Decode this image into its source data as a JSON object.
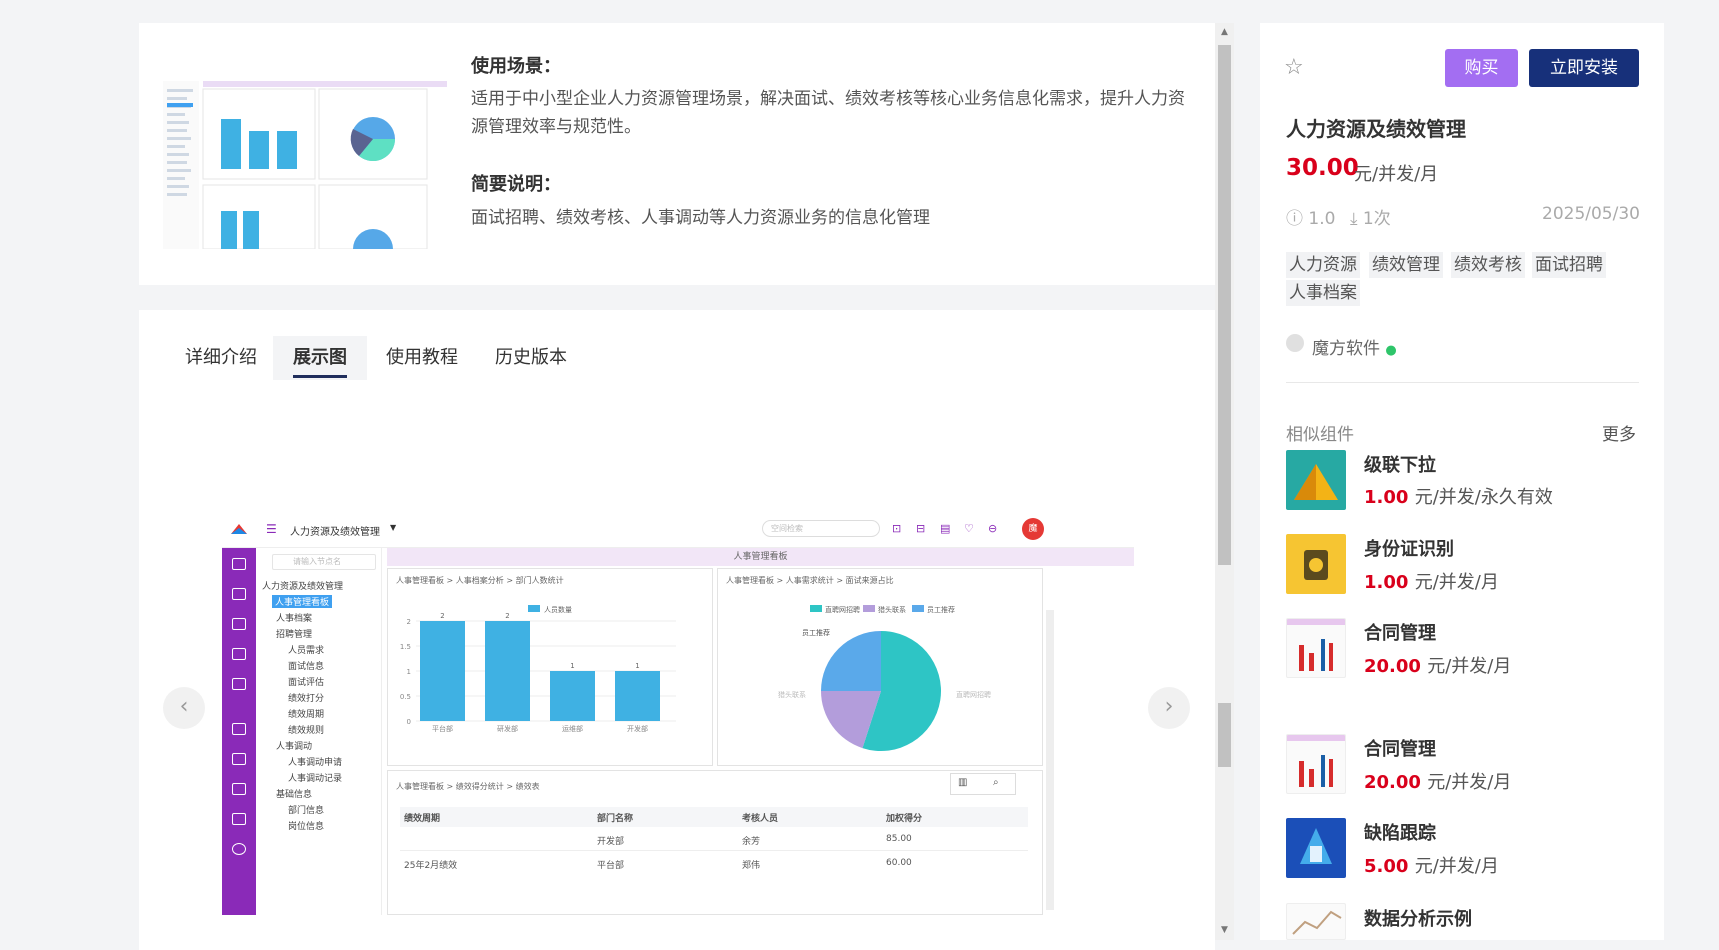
{
  "overview": {
    "scene_title": "使用场景：",
    "scene_text": "适用于中小型企业人力资源管理场景，解决面试、绩效考核等核心业务信息化需求，提升人力资源管理效率与规范性。",
    "brief_title": "简要说明：",
    "brief_text": "面试招聘、绩效考核、人事调动等人力资源业务的信息化管理"
  },
  "tabs": [
    "详细介绍",
    "展示图",
    "使用教程",
    "历史版本"
  ],
  "active_tab": "展示图",
  "carousel": {
    "prev": "‹",
    "next": "›"
  },
  "screenshot": {
    "app_title": "人力资源及绩效管理",
    "search_placeholder": "空间检索",
    "avatar_text": "魔",
    "tree_search_placeholder": "请输入节点名",
    "dashboard_title": "人事管理看板",
    "tree": [
      "人力资源及绩效管理",
      "人事管理看板",
      "人事档案",
      "招聘管理",
      "人员需求",
      "面试信息",
      "面试评估",
      "绩效打分",
      "绩效周期",
      "绩效规则",
      "人事调动",
      "人事调动申请",
      "人事调动记录",
      "基础信息",
      "部门信息",
      "岗位信息"
    ],
    "bar_panel": {
      "breadcrumb": "人事管理看板 > 人事档案分析 > 部门人数统计",
      "legend": "人员数量",
      "categories": [
        "平台部",
        "研发部",
        "运维部",
        "开发部"
      ],
      "values": [
        2,
        2,
        1,
        1
      ],
      "y_ticks": [
        "2",
        "1.5",
        "1",
        "0.5",
        "0"
      ]
    },
    "pie_panel": {
      "breadcrumb": "人事管理看板 > 人事需求统计 > 面试来源占比",
      "legend": [
        "直聘网招聘",
        "猎头联系",
        "员工推荐"
      ],
      "label_top": "员工推荐",
      "label_left": "猎头联系",
      "label_right": "直聘网招聘",
      "values": [
        55,
        20,
        25
      ],
      "colors": [
        "#2ec5c5",
        "#b39ddb",
        "#5aa9ea"
      ]
    },
    "table_panel": {
      "breadcrumb": "人事管理看板 > 绩效得分统计 > 绩效表",
      "headers": [
        "绩效周期",
        "部门名称",
        "考核人员",
        "加权得分"
      ],
      "rows": [
        [
          "",
          "开发部",
          "余芳",
          "85.00"
        ],
        [
          "25年2月绩效",
          "平台部",
          "郑伟",
          "60.00"
        ]
      ]
    }
  },
  "product": {
    "buy_label": "购买",
    "install_label": "立即安装",
    "name": "人力资源及绩效管理",
    "price": "30.00",
    "price_unit": "元/并发/月",
    "version": "1.0",
    "downloads": "1次",
    "date": "2025/05/30",
    "tags": [
      "人力资源",
      "绩效管理",
      "绩效考核",
      "面试招聘",
      "人事档案"
    ],
    "vendor": "魔方软件"
  },
  "similar": {
    "title": "相似组件",
    "more": "更多",
    "items": [
      {
        "name": "级联下拉",
        "price": "1.00",
        "unit": "元/并发/永久有效"
      },
      {
        "name": "身份证识别",
        "price": "1.00",
        "unit": "元/并发/月"
      },
      {
        "name": "合同管理",
        "price": "20.00",
        "unit": "元/并发/月"
      },
      {
        "name": "合同管理",
        "price": "20.00",
        "unit": "元/并发/月"
      },
      {
        "name": "缺陷跟踪",
        "price": "5.00",
        "unit": "元/并发/月"
      },
      {
        "name": "数据分析示例",
        "price": "",
        "unit": ""
      }
    ]
  },
  "colors": {
    "buy": "#a36ef2",
    "install": "#17307a",
    "price": "#d9001b",
    "rail": "#8a2ab8",
    "bar": "#3fb1e3"
  }
}
